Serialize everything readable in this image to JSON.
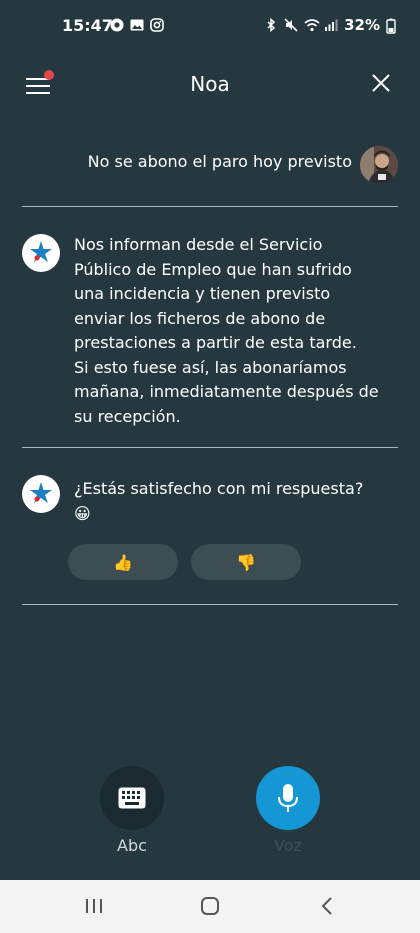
{
  "status": {
    "time": "15:47",
    "battery": "32%",
    "left_icons": [
      "chrome-icon",
      "gallery-icon",
      "instagram-icon"
    ],
    "right_icons": [
      "bluetooth-icon",
      "mute-icon",
      "wifi-icon",
      "signal-icon",
      "battery-icon"
    ]
  },
  "header": {
    "title": "Noa",
    "notification_color": "#e0474c"
  },
  "conversation": {
    "user_message": "No se abono el paro hoy previsto",
    "bot_message_lines": [
      "Nos informan desde el Servicio",
      "Público de Empleo que han sufrido",
      "una incidencia y tienen previsto",
      "enviar los ficheros de abono de",
      "prestaciones a partir de esta tarde.",
      "Si esto fuese así, las abonaríamos",
      "mañana, inmediatamente después de",
      "su recepción."
    ],
    "bot_question": "¿Estás satisfecho con mi respuesta?",
    "bot_question_emoji": "😀",
    "thumbs_up": "👍",
    "thumbs_down": "👎"
  },
  "actions": {
    "keyboard_label": "Abc",
    "voice_label": "Voz",
    "voice_color": "#1597d6",
    "keyboard_color": "#1b2a31"
  },
  "colors": {
    "background": "#26383f",
    "brand_blue": "#1a7fc4"
  }
}
